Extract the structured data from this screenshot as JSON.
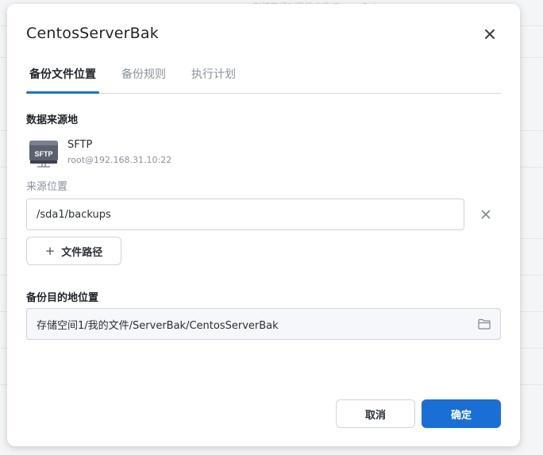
{
  "background": {
    "faded_text": "在储空间1/我的文件/ServerBak"
  },
  "dialog": {
    "title": "CentosServerBak",
    "close_icon": "close-icon"
  },
  "tabs": [
    {
      "label": "备份文件位置",
      "active": true
    },
    {
      "label": "备份规则",
      "active": false
    },
    {
      "label": "执行计划",
      "active": false
    }
  ],
  "source": {
    "section_label": "数据来源地",
    "icon": "sftp-server-icon",
    "icon_text": "SFTP",
    "type": "SFTP",
    "host": "root@192.168.31.10:22",
    "location_label": "来源位置",
    "path_value": "/sda1/backups",
    "add_path_label": "文件路径"
  },
  "destination": {
    "section_label": "备份目的地位置",
    "path_value": "存储空间1/我的文件/ServerBak/CentosServerBak",
    "icon": "folder-icon"
  },
  "footer": {
    "cancel_label": "取消",
    "ok_label": "确定"
  },
  "colors": {
    "accent": "#1a6fd6",
    "text_primary": "#1f2329",
    "text_muted": "#8a929e"
  }
}
